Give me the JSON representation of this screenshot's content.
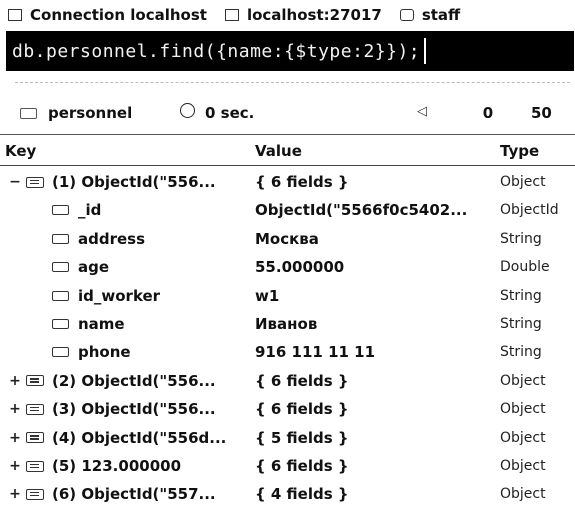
{
  "connection_bar": {
    "connection": "Connection localhost",
    "server": "localhost:27017",
    "database": "staff"
  },
  "query": {
    "text": "db.personnel.find({name:{$type:2}});"
  },
  "result_bar": {
    "collection": "personnel",
    "time": "0 sec.",
    "prev_icon": "◁",
    "page_from": "0",
    "page_size": "50"
  },
  "columns": {
    "key": "Key",
    "value": "Value",
    "type": "Type"
  },
  "rows": [
    {
      "expander": "−",
      "key": "(1) ObjectId(\"556...",
      "value": "{ 6 fields }",
      "type": "Object"
    },
    {
      "expander": "",
      "key": "_id",
      "value": "ObjectId(\"5566f0c5402...",
      "type": "ObjectId"
    },
    {
      "expander": "",
      "key": "address",
      "value": "Москва",
      "type": "String"
    },
    {
      "expander": "",
      "key": "age",
      "value": "55.000000",
      "type": "Double"
    },
    {
      "expander": "",
      "key": "id_worker",
      "value": "w1",
      "type": "String"
    },
    {
      "expander": "",
      "key": "name",
      "value": "Иванов",
      "type": "String"
    },
    {
      "expander": "",
      "key": "phone",
      "value": "916 111 11 11",
      "type": "String"
    },
    {
      "expander": "+",
      "key": "(2) ObjectId(\"556...",
      "value": "{ 6 fields }",
      "type": "Object"
    },
    {
      "expander": "+",
      "key": "(3) ObjectId(\"556...",
      "value": "{ 6 fields }",
      "type": "Object"
    },
    {
      "expander": "+",
      "key": "(4) ObjectId(\"556d...",
      "value": "{ 5 fields }",
      "type": "Object"
    },
    {
      "expander": "+",
      "key": "(5) 123.000000",
      "value": "{ 6 fields }",
      "type": "Object"
    },
    {
      "expander": "+",
      "key": "(6) ObjectId(\"557...",
      "value": "{ 4 fields }",
      "type": "Object"
    }
  ]
}
